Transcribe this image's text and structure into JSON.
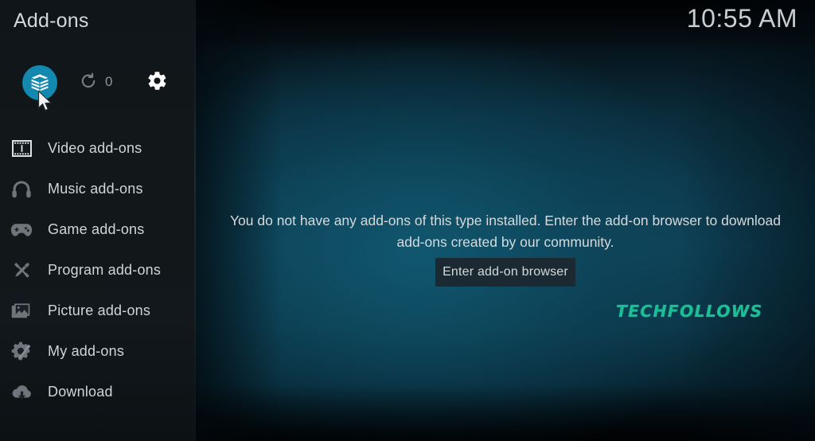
{
  "header": {
    "title": "Add-ons",
    "clock": "10:55 AM"
  },
  "toolbar": {
    "addons_icon": "addon-box-icon",
    "addons_label": "Add-on browser",
    "refresh_icon": "refresh-icon",
    "update_count": "0",
    "settings_icon": "gear-icon",
    "settings_label": "Settings",
    "accent_color": "#1489b0"
  },
  "sidebar": {
    "items": [
      {
        "label": "Video add-ons",
        "icon": "film-strip-icon",
        "selected": true
      },
      {
        "label": "Music add-ons",
        "icon": "headphones-icon",
        "selected": false
      },
      {
        "label": "Game add-ons",
        "icon": "gamepad-icon",
        "selected": false
      },
      {
        "label": "Program add-ons",
        "icon": "tools-crossed-icon",
        "selected": false
      },
      {
        "label": "Picture add-ons",
        "icon": "picture-frame-icon",
        "selected": false
      },
      {
        "label": "My add-ons",
        "icon": "gear-screwdriver-icon",
        "selected": false
      },
      {
        "label": "Download",
        "icon": "cloud-download-icon",
        "selected": false
      }
    ]
  },
  "main": {
    "empty_message": "You do not have any add-ons of this type installed. Enter the add-on browser to download add-ons created by our community.",
    "enter_browser_label": "Enter add-on browser",
    "watermark": "TECHFOLLOWS",
    "watermark_color": "#1bbf95"
  },
  "cursor": {
    "icon": "mouse-pointer-icon"
  }
}
